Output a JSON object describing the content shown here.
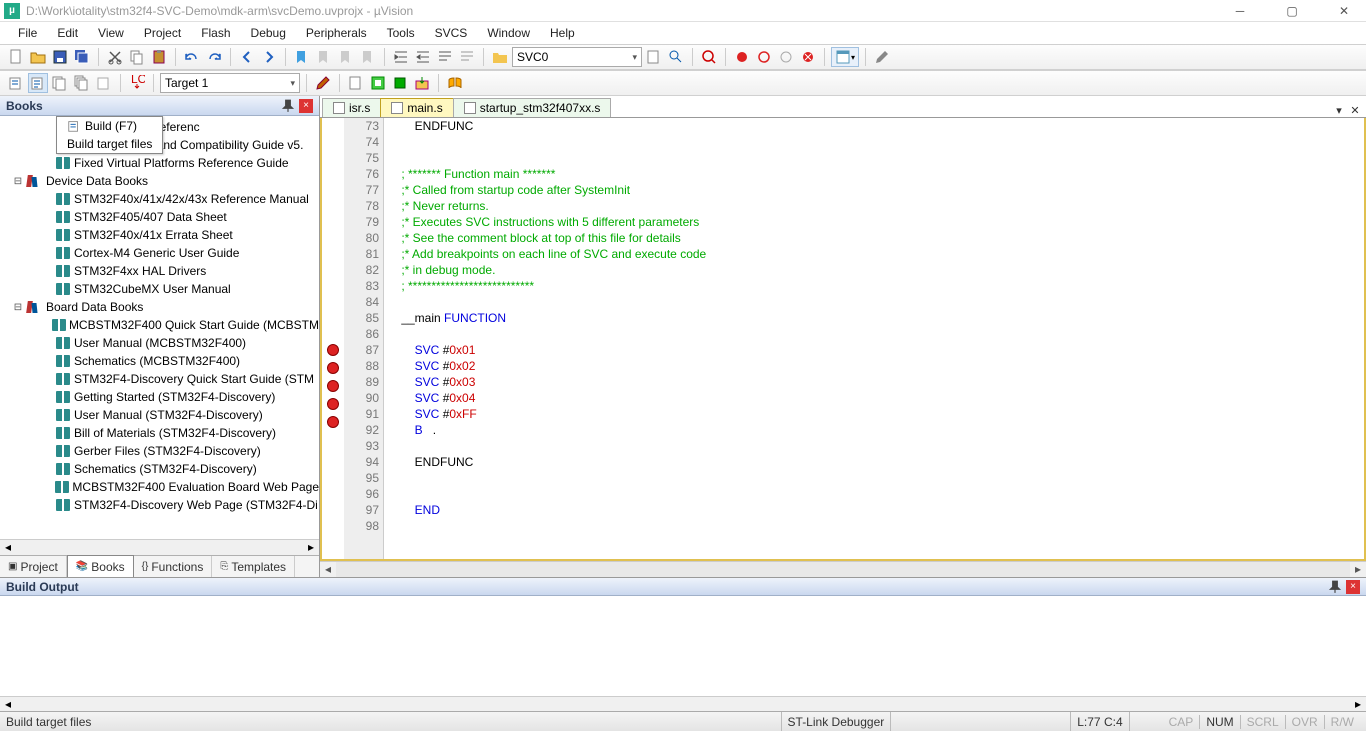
{
  "window": {
    "title": "D:\\Work\\iotality\\stm32f4-SVC-Demo\\mdk-arm\\svcDemo.uvprojx - µVision"
  },
  "menu": [
    "File",
    "Edit",
    "View",
    "Project",
    "Flash",
    "Debug",
    "Peripherals",
    "Tools",
    "SVCS",
    "Window",
    "Help"
  ],
  "toolbar1": {
    "search": "SVC0"
  },
  "toolbar2": {
    "target": "Target 1"
  },
  "tooltip": {
    "title": "Build (F7)",
    "desc": "Build target files"
  },
  "panel": {
    "title": "Books",
    "tabs": [
      "Project",
      "Books",
      "Functions",
      "Templates"
    ],
    "active_tab": 1,
    "groups": [
      {
        "label": "Device Data Books",
        "style": "group",
        "indent": 12,
        "pre_items": [
          "and Warnings Referenc",
          "ARM Migration and Compatibility Guide v5.",
          "Fixed Virtual Platforms Reference Guide"
        ],
        "items": [
          "STM32F40x/41x/42x/43x Reference Manual",
          "STM32F405/407 Data Sheet",
          "STM32F40x/41x Errata Sheet",
          "Cortex-M4 Generic User Guide",
          "STM32F4xx HAL Drivers",
          "STM32CubeMX User Manual"
        ]
      },
      {
        "label": "Board Data Books",
        "style": "group",
        "indent": 12,
        "items": [
          "MCBSTM32F400 Quick Start Guide (MCBSTM",
          "User Manual (MCBSTM32F400)",
          "Schematics (MCBSTM32F400)",
          "STM32F4-Discovery Quick Start Guide (STM",
          "Getting Started (STM32F4-Discovery)",
          "User Manual (STM32F4-Discovery)",
          "Bill of Materials (STM32F4-Discovery)",
          "Gerber Files (STM32F4-Discovery)",
          "Schematics (STM32F4-Discovery)",
          "MCBSTM32F400 Evaluation Board Web Page",
          "STM32F4-Discovery Web Page (STM32F4-Di"
        ]
      }
    ]
  },
  "editor": {
    "tabs": [
      {
        "label": "isr.s",
        "active": false
      },
      {
        "label": "main.s",
        "active": true
      },
      {
        "label": "startup_stm32f407xx.s",
        "active": false
      }
    ],
    "first_line": 73,
    "breakpoints": [
      87,
      88,
      89,
      90,
      91
    ],
    "lines": [
      {
        "n": 73,
        "segs": [
          {
            "t": "        ENDFUNC"
          }
        ]
      },
      {
        "n": 74,
        "segs": []
      },
      {
        "n": 75,
        "segs": []
      },
      {
        "n": 76,
        "segs": [
          {
            "t": "    ; ******* Function main *******",
            "c": "c-green"
          }
        ]
      },
      {
        "n": 77,
        "segs": [
          {
            "t": "    ;* Called from startup code after SystemInit",
            "c": "c-green"
          }
        ]
      },
      {
        "n": 78,
        "segs": [
          {
            "t": "    ;* Never returns.",
            "c": "c-green"
          }
        ]
      },
      {
        "n": 79,
        "segs": [
          {
            "t": "    ;* Executes SVC instructions with 5 different parameters",
            "c": "c-green"
          }
        ]
      },
      {
        "n": 80,
        "segs": [
          {
            "t": "    ;* See the comment block at top of this file for details",
            "c": "c-green"
          }
        ]
      },
      {
        "n": 81,
        "segs": [
          {
            "t": "    ;* Add breakpoints on each line of SVC and execute code",
            "c": "c-green"
          }
        ]
      },
      {
        "n": 82,
        "segs": [
          {
            "t": "    ;* in debug mode.",
            "c": "c-green"
          }
        ]
      },
      {
        "n": 83,
        "segs": [
          {
            "t": "    ; ***************************",
            "c": "c-green"
          }
        ]
      },
      {
        "n": 84,
        "segs": []
      },
      {
        "n": 85,
        "segs": [
          {
            "t": "    __main "
          },
          {
            "t": "FUNCTION",
            "c": "c-blue"
          }
        ]
      },
      {
        "n": 86,
        "segs": []
      },
      {
        "n": 87,
        "segs": [
          {
            "t": "        "
          },
          {
            "t": "SVC",
            "c": "c-blue"
          },
          {
            "t": " #"
          },
          {
            "t": "0x01",
            "c": "c-red"
          }
        ]
      },
      {
        "n": 88,
        "segs": [
          {
            "t": "        "
          },
          {
            "t": "SVC",
            "c": "c-blue"
          },
          {
            "t": " #"
          },
          {
            "t": "0x02",
            "c": "c-red"
          }
        ]
      },
      {
        "n": 89,
        "segs": [
          {
            "t": "        "
          },
          {
            "t": "SVC",
            "c": "c-blue"
          },
          {
            "t": " #"
          },
          {
            "t": "0x03",
            "c": "c-red"
          }
        ]
      },
      {
        "n": 90,
        "segs": [
          {
            "t": "        "
          },
          {
            "t": "SVC",
            "c": "c-blue"
          },
          {
            "t": " #"
          },
          {
            "t": "0x04",
            "c": "c-red"
          }
        ]
      },
      {
        "n": 91,
        "segs": [
          {
            "t": "        "
          },
          {
            "t": "SVC",
            "c": "c-blue"
          },
          {
            "t": " #"
          },
          {
            "t": "0xFF",
            "c": "c-red"
          }
        ]
      },
      {
        "n": 92,
        "segs": [
          {
            "t": "        "
          },
          {
            "t": "B",
            "c": "c-blue"
          },
          {
            "t": "   ."
          }
        ]
      },
      {
        "n": 93,
        "segs": []
      },
      {
        "n": 94,
        "segs": [
          {
            "t": "        ENDFUNC"
          }
        ]
      },
      {
        "n": 95,
        "segs": []
      },
      {
        "n": 96,
        "segs": []
      },
      {
        "n": 97,
        "segs": [
          {
            "t": "        "
          },
          {
            "t": "END",
            "c": "c-blue"
          }
        ]
      },
      {
        "n": 98,
        "segs": []
      }
    ]
  },
  "build": {
    "title": "Build Output"
  },
  "status": {
    "left": "Build target files",
    "debugger": "ST-Link Debugger",
    "pos": "L:77 C:4",
    "indicators": [
      "CAP",
      "NUM",
      "SCRL",
      "OVR",
      "R/W"
    ],
    "active_indicator": 1
  }
}
